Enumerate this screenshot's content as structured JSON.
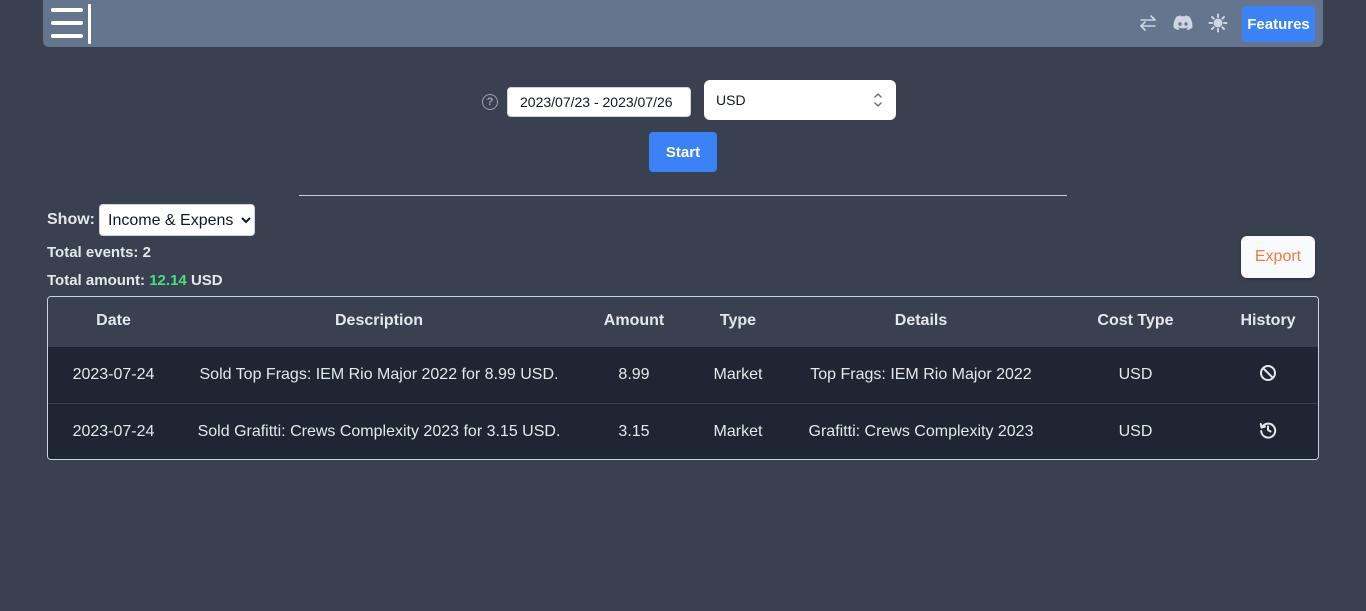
{
  "topbar": {
    "features_label": "Features",
    "icons": [
      "switch-arrows-icon",
      "discord-icon",
      "theme-sun-icon"
    ]
  },
  "controls": {
    "date_range": "2023/07/23 - 2023/07/26",
    "currency": "USD",
    "start_label": "Start",
    "help_glyph": "?"
  },
  "summary": {
    "show_label": "Show:",
    "show_selected": "Income & Expense",
    "total_events_label": "Total events:",
    "total_events": "2",
    "total_amount_label": "Total amount:",
    "total_amount": "12.14",
    "total_amount_currency": "USD",
    "export_label": "Export"
  },
  "table": {
    "headers": [
      "Date",
      "Description",
      "Amount",
      "Type",
      "Details",
      "Cost Type",
      "History"
    ],
    "rows": [
      {
        "date": "2023-07-24",
        "description": "Sold Top Frags: IEM Rio Major 2022 for 8.99 USD.",
        "amount": "8.99",
        "type": "Market",
        "details": "Top Frags: IEM Rio Major 2022",
        "cost_type": "USD",
        "history_icon": "ban-icon"
      },
      {
        "date": "2023-07-24",
        "description": "Sold Grafitti: Crews Complexity 2023 for 3.15 USD.",
        "amount": "3.15",
        "type": "Market",
        "details": "Grafitti: Crews Complexity 2023",
        "cost_type": "USD",
        "history_icon": "history-icon"
      }
    ]
  },
  "colors": {
    "background": "#394150",
    "topbar": "#65758d",
    "accent_blue": "#3b82f6",
    "positive_green": "#4ade80",
    "export_orange": "#f07a3c",
    "row_bg": "#1f2633"
  }
}
